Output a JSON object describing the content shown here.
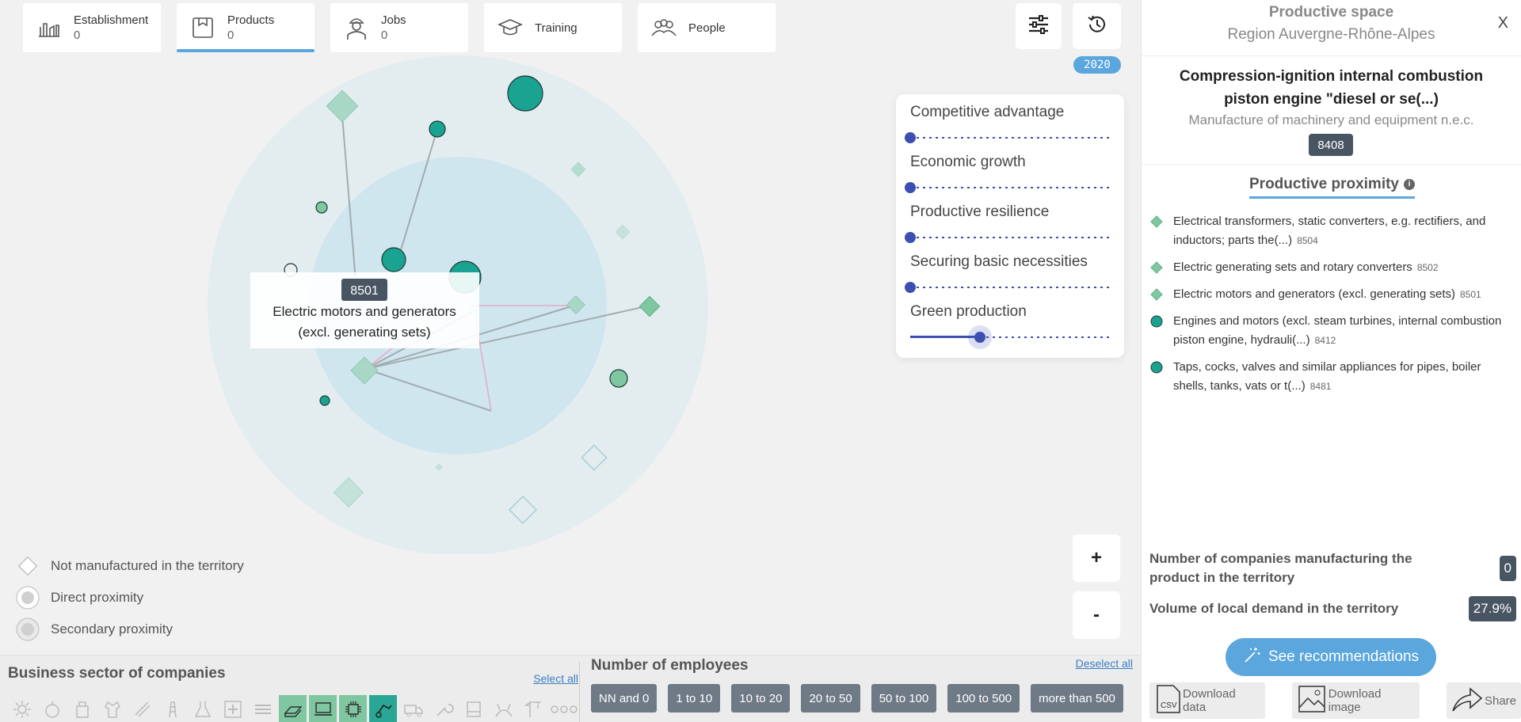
{
  "tabs": [
    {
      "name": "Establishment",
      "count": "0",
      "icon": "factory-icon"
    },
    {
      "name": "Products",
      "count": "0",
      "icon": "product-box-icon"
    },
    {
      "name": "Jobs",
      "count": "0",
      "icon": "worker-icon"
    },
    {
      "name": "Training",
      "count": "",
      "icon": "graduation-cap-icon"
    },
    {
      "name": "People",
      "count": "",
      "icon": "people-icon"
    }
  ],
  "year": "2020",
  "tooltip": {
    "code": "8501",
    "line1": "Electric motors and generators",
    "line2": "(excl. generating sets)"
  },
  "filters": [
    {
      "label": "Competitive advantage",
      "level": 0
    },
    {
      "label": "Economic growth",
      "level": 0
    },
    {
      "label": "Productive resilience",
      "level": 0
    },
    {
      "label": "Securing basic necessities",
      "level": 0
    },
    {
      "label": "Green production",
      "level": 0.35
    }
  ],
  "zoom": {
    "in": "+",
    "out": "-"
  },
  "legend": [
    {
      "label": "Not manufactured in the territory",
      "icon": "diamond-outline-icon"
    },
    {
      "label": "Direct proximity",
      "icon": "direct-proximity-icon"
    },
    {
      "label": "Secondary proximity",
      "icon": "secondary-proximity-icon"
    }
  ],
  "sector": {
    "title": "Business sector of companies",
    "select_all": "Select all"
  },
  "employees": {
    "title": "Number of employees",
    "deselect_all": "Deselect all",
    "ranges": [
      "NN and 0",
      "1 to 10",
      "10 to 20",
      "20 to 50",
      "50 to 100",
      "100 to 500",
      "more than 500"
    ]
  },
  "panel": {
    "title": "Productive space",
    "region": "Region Auvergne-Rhône-Alpes",
    "close": "X",
    "product_title": "Compression-ignition internal combustion piston engine \"diesel or se(...)",
    "product_sector": "Manufacture of machinery and equipment n.e.c.",
    "product_code": "8408",
    "proximity_title": "Productive proximity",
    "proximity_info": "i",
    "items": [
      {
        "text": "Electrical transformers, static converters, e.g. rectifiers, and inductors; parts the(...)",
        "code": "8504",
        "marker": "diamond",
        "color": "#7fc7a0"
      },
      {
        "text": "Electric generating sets and rotary converters",
        "code": "8502",
        "marker": "diamond",
        "color": "#7fc7a0"
      },
      {
        "text": "Electric motors and generators (excl. generating sets)",
        "code": "8501",
        "marker": "diamond",
        "color": "#7fc7a0"
      },
      {
        "text": "Engines and motors (excl. steam turbines, internal combustion piston engine, hydrauli(...)",
        "code": "8412",
        "marker": "circle",
        "color": "#1aa391"
      },
      {
        "text": "Taps, cocks, valves and similar appliances for pipes, boiler shells, tanks, vats or t(...)",
        "code": "8481",
        "marker": "circle",
        "color": "#1aa391"
      }
    ],
    "stat_companies_label": "Number of companies manufacturing the product in the territory",
    "stat_companies_value": "0",
    "stat_demand_label": "Volume of local demand in the territory",
    "stat_demand_value": "27.9%",
    "recommendations": "See recommendations",
    "download_data": "Download data",
    "download_image": "Download image",
    "share": "Share"
  },
  "colors": {
    "accent": "#5aa6dd",
    "dark_teal": "#1aa391",
    "light_green": "#7fc7a0",
    "slider": "#3c4eb0",
    "badge": "#4a5564"
  }
}
